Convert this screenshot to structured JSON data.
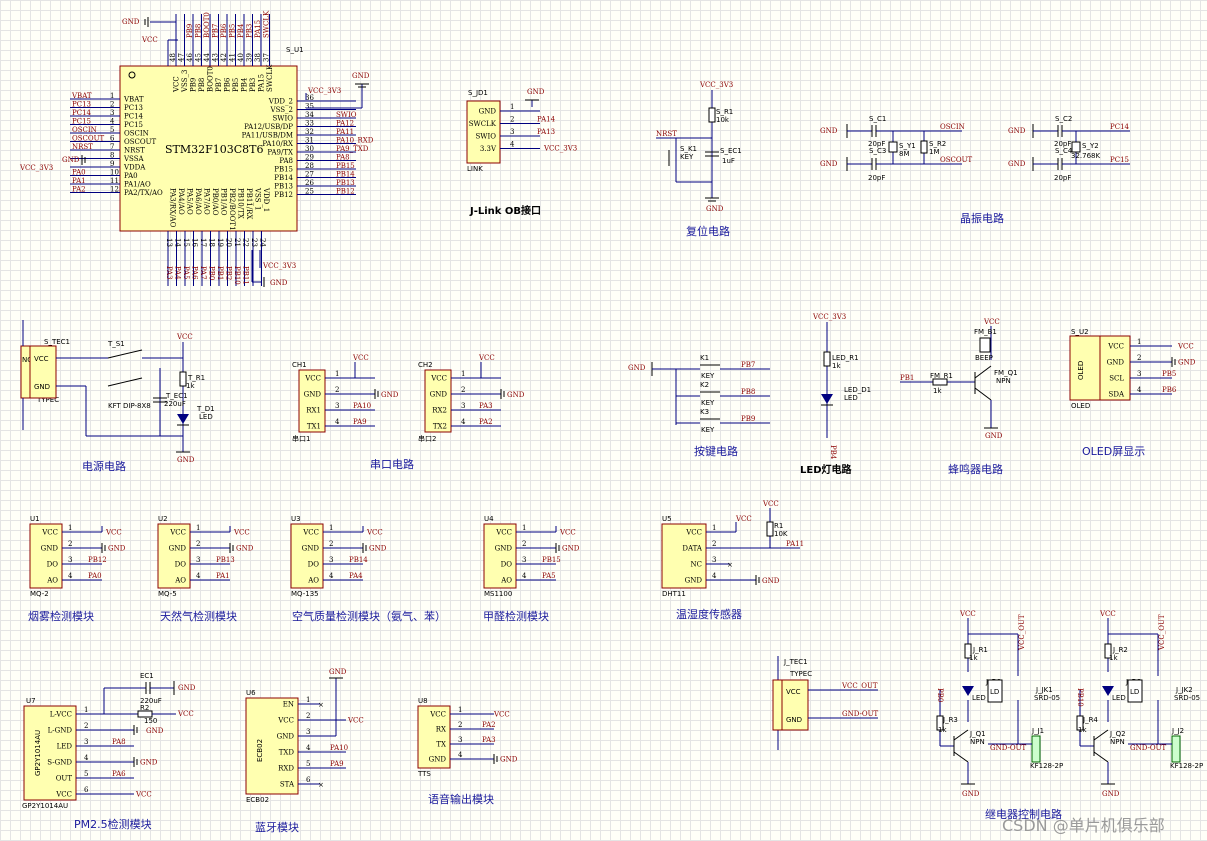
{
  "mcu": {
    "ref": "S_U1",
    "part": "STM32F103C8T6",
    "left_pins": [
      "VBAT",
      "PC13",
      "PC14",
      "PC15",
      "OSCIN",
      "OSCOUT",
      "NRST",
      "VSSA",
      "VDDA",
      "PA0",
      "PA1/AO",
      "PA2/TX/AO"
    ],
    "left_nums": [
      "1",
      "2",
      "3",
      "4",
      "5",
      "6",
      "7",
      "8",
      "9",
      "10",
      "11",
      "12"
    ],
    "left_nets": [
      "VBAT",
      "PC13",
      "PC14",
      "PC15",
      "OSCIN",
      "OSCOUT",
      "NRST",
      "GND",
      "VCC_3V3",
      "PA0",
      "PA1",
      "PA2"
    ],
    "right_pins": [
      "VDD_2",
      "VSS_2",
      "SWIO",
      "PA12/USB/DP",
      "PA11/USB/DM",
      "PA10/RX",
      "PA9/TX",
      "PA8",
      "PB15",
      "PB14",
      "PB13",
      "PB12"
    ],
    "right_nums": [
      "36",
      "35",
      "34",
      "33",
      "32",
      "31",
      "30",
      "29",
      "28",
      "27",
      "26",
      "25"
    ],
    "right_nets": [
      "VCC_3V3",
      "",
      "SWIO",
      "PA12",
      "PA11",
      "PA10_RXD",
      "PA9_TXD",
      "PA8",
      "PB15",
      "PB14",
      "PB13",
      "PB12"
    ],
    "top_pins": [
      "VCC",
      "VSS_3",
      "PB9",
      "PB8",
      "BOOT0",
      "PB7",
      "PB6",
      "PB5",
      "PB4",
      "PB3",
      "PA15",
      "SWCLK"
    ],
    "top_nums": [
      "48",
      "47",
      "46",
      "45",
      "44",
      "43",
      "42",
      "41",
      "40",
      "39",
      "38",
      "37"
    ],
    "top_nets": [
      "",
      "",
      "PB9",
      "PB8",
      "BOOT0",
      "PB7",
      "PB6",
      "PB5",
      "PB4",
      "PB3",
      "PA15",
      "SWCLK"
    ],
    "bottom_pins": [
      "PA3/RX/AO",
      "PA4/AO",
      "PA5/AO",
      "PA6/AO",
      "PA7/AO",
      "PB0/AO",
      "PB1/AO",
      "PB2/BOOT1",
      "PB10/TX",
      "PB11/RX",
      "VSS_1",
      "VDD_1"
    ],
    "bottom_nums": [
      "13",
      "14",
      "15",
      "16",
      "17",
      "18",
      "19",
      "20",
      "21",
      "22",
      "23",
      "24"
    ],
    "bottom_nets": [
      "PA3",
      "PA4",
      "PA5",
      "PA6",
      "PA7",
      "PB0",
      "PB1",
      "PB2",
      "PB10",
      "PB11",
      "",
      ""
    ]
  },
  "nets": {
    "gnd": "GND",
    "vcc": "VCC",
    "vcc33": "VCC_3V3"
  },
  "jlink": {
    "ref": "S_JD1",
    "sub": "LINK",
    "pins": [
      "GND",
      "SWCLK",
      "SWIO",
      "3.3V"
    ],
    "nets": [
      "GND",
      "PA14",
      "PA13",
      "VCC_3V3"
    ],
    "title": "J-Link OB接口"
  },
  "reset": {
    "r": "S_R1",
    "rv": "10k",
    "nrst": "NRST",
    "key_ref": "S_K1",
    "key": "KEY",
    "cap": "S_EC1",
    "capv": "1uF",
    "title": "复位电路"
  },
  "crystal": {
    "c1": "S_C1",
    "c2": "S_C2",
    "c3": "S_C3",
    "c4": "S_C4",
    "cv": "20pF",
    "y1": "S_Y1",
    "y1v": "8M",
    "y2": "S_Y2",
    "y2v": "32.768K",
    "r2": "S_R2",
    "r2v": "1M",
    "oscin": "OSCIN",
    "oscout": "OSCOUT",
    "pc14": "PC14",
    "pc15": "PC15",
    "title": "晶振电路"
  },
  "power": {
    "tec": "S_TEC1",
    "tec_type": "TYPEC",
    "nc": "NC",
    "vcc_pin": "VCC",
    "gnd_pin": "GND",
    "sw": "T_S1",
    "sw_part": "KFT DIP-8X8",
    "cap": "T_EC1",
    "capv": "220uF",
    "r": "T_R1",
    "rv": "1k",
    "led": "T_D1",
    "ledt": "LED",
    "title": "电源电路"
  },
  "uart": {
    "ch1": "CH1",
    "ch2": "CH2",
    "pins": [
      "VCC",
      "GND",
      "RX1",
      "TX1"
    ],
    "pins2": [
      "VCC",
      "GND",
      "RX2",
      "TX2"
    ],
    "n1": [
      "PA10",
      "PA9"
    ],
    "n2": [
      "PA3",
      "PA2"
    ],
    "u1": "串口1",
    "u2": "串口2",
    "title": "串口电路"
  },
  "keys": {
    "k": [
      "K1",
      "K2",
      "K3"
    ],
    "key": "KEY",
    "nets": [
      "PB7",
      "PB8",
      "PB9"
    ],
    "title": "按键电路"
  },
  "ledc": {
    "r": "LED_R1",
    "rv": "1k",
    "d": "LED_D1",
    "dt": "LED",
    "net": "PB4",
    "title": "LED灯电路"
  },
  "buzzer": {
    "fm": "FM_B1",
    "fmt": "BEEP",
    "q": "FM_Q1",
    "qt": "NPN",
    "r": "FM_R1",
    "rv": "1k",
    "net": "PB1",
    "title": "蜂鸣器电路"
  },
  "oled": {
    "ref": "S_U2",
    "part": "OLED",
    "pins": [
      "VCC",
      "GND",
      "SCL",
      "SDA"
    ],
    "nets": [
      "VCC",
      "GND",
      "PB5",
      "PB6"
    ],
    "title": "OLED屏显示"
  },
  "sensors": [
    {
      "ref": "U1",
      "part": "MQ-2",
      "pins": [
        "VCC",
        "GND",
        "DO",
        "AO"
      ],
      "nets": [
        "VCC",
        "GND",
        "PB12",
        "PA0"
      ],
      "title": "烟雾检测模块"
    },
    {
      "ref": "U2",
      "part": "MQ-5",
      "pins": [
        "VCC",
        "GND",
        "DO",
        "AO"
      ],
      "nets": [
        "VCC",
        "GND",
        "PB13",
        "PA1"
      ],
      "title": "天然气检测模块"
    },
    {
      "ref": "U3",
      "part": "MQ-135",
      "pins": [
        "VCC",
        "GND",
        "DO",
        "AO"
      ],
      "nets": [
        "VCC",
        "GND",
        "PB14",
        "PA4"
      ],
      "title": "空气质量检测模块（氨气、苯）"
    },
    {
      "ref": "U4",
      "part": "MS1100",
      "pins": [
        "VCC",
        "GND",
        "DO",
        "AO"
      ],
      "nets": [
        "VCC",
        "GND",
        "PB15",
        "PA5"
      ],
      "title": "甲醛检测模块"
    }
  ],
  "dht": {
    "ref": "U5",
    "part": "DHT11",
    "pins": [
      "VCC",
      "DATA",
      "NC",
      "GND"
    ],
    "r": "R1",
    "rv": "10K",
    "net": "PA11",
    "title": "温湿度传感器"
  },
  "pm25": {
    "ref": "U7",
    "part": "GP2Y1014AU",
    "pins": [
      "L-VCC",
      "L-GND",
      "LED",
      "S-GND",
      "OUT",
      "VCC"
    ],
    "nets": [
      "",
      "",
      "PA8",
      "GND",
      "PA6",
      "VCC"
    ],
    "ec": "EC1",
    "ecv": "220uF",
    "r": "R2",
    "rv": "150",
    "title": "PM2.5检测模块"
  },
  "bt": {
    "ref": "U6",
    "part": "ECB02",
    "pins": [
      "EN",
      "VCC",
      "GND",
      "TXD",
      "RXD",
      "STA"
    ],
    "nets": [
      "",
      "VCC",
      "",
      "PA10",
      "PA9",
      ""
    ],
    "title": "蓝牙模块"
  },
  "tts": {
    "ref": "U8",
    "part": "TTS",
    "pins": [
      "VCC",
      "RX",
      "TX",
      "GND"
    ],
    "nets": [
      "VCC",
      "PA2",
      "PA3",
      "GND"
    ],
    "title": "语音输出模块"
  },
  "jtec": {
    "ref": "J_TEC1",
    "type": "TYPEC",
    "nets": [
      "VCC_OUT",
      "GND-OUT"
    ]
  },
  "relay": {
    "r1": "J_R1",
    "r2": "J_R2",
    "d1": "J_D1",
    "d2": "J_D2",
    "q1": "J_Q1",
    "q2": "J_Q2",
    "r3": "J_R3",
    "r4": "J_R4",
    "jk1": "J_JK1",
    "jk2": "J_JK2",
    "srd": "SRD-05",
    "j1": "J_J1",
    "j2": "J_J2",
    "kf": "KF128-2P",
    "rv": "1k",
    "npn": "NPN",
    "led": "LED",
    "ld": "LD",
    "vcc_out": "VCC_OUT",
    "gnd_out": "GND-OUT",
    "net1": "PB0",
    "net2": "PB10",
    "title": "继电器控制电路"
  },
  "watermark": "CSDN @单片机俱乐部"
}
